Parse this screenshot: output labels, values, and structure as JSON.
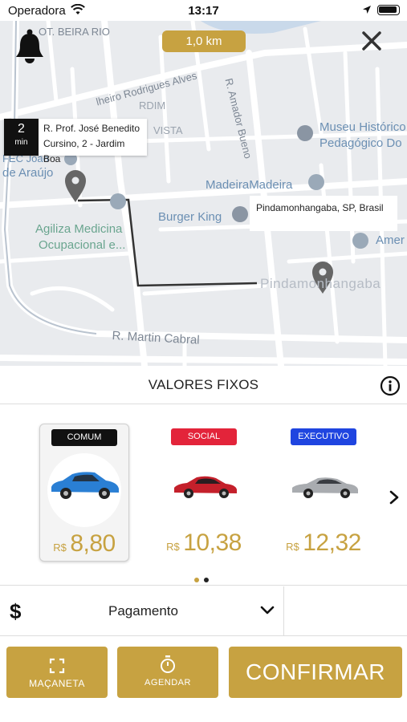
{
  "status_bar": {
    "carrier": "Operadora",
    "time": "13:17"
  },
  "map": {
    "distance": "1,0 km",
    "streets": [
      "OT. BEIRA RIO",
      "lheiro Rodrigues Alves",
      "R. Amador Bueno",
      "R. Martin Cabral"
    ],
    "pois": [
      "Museu Histórico",
      "Pedagógico Do",
      "MadeiraMadeira",
      "Burger King",
      "Agiliza Medicina",
      "Ocupacional e...",
      "Amer",
      "RDIM",
      "VISTA",
      "de Araújo",
      "FEC João"
    ],
    "town": "Pindamonhangaba",
    "origin": {
      "eta_value": "2",
      "eta_unit": "min",
      "address_line1": "R. Prof. José Benedito",
      "address_line2": "Cursino, 2 - Jardim Boa"
    },
    "destination": "Pindamonhangaba, SP, Brasil"
  },
  "fixed_values": {
    "title": "VALORES FIXOS"
  },
  "cars": [
    {
      "category": "COMUM",
      "currency": "R$",
      "price": "8,80",
      "badge_color": "#111111",
      "car_color": "#2a7fd4",
      "selected": true
    },
    {
      "category": "SOCIAL",
      "currency": "R$",
      "price": "10,38",
      "badge_color": "#e3243a",
      "car_color": "#c4202b",
      "selected": false
    },
    {
      "category": "EXECUTIVO",
      "currency": "R$",
      "price": "12,32",
      "badge_color": "#1f45e0",
      "car_color": "#a9acb0",
      "selected": false
    }
  ],
  "carousel": {
    "page": 1,
    "pages": 2
  },
  "payment": {
    "icon": "$",
    "label": "Pagamento"
  },
  "actions": {
    "handle_label": "MAÇANETA",
    "schedule_label": "AGENDAR",
    "confirm_label": "CONFIRMAR"
  },
  "colors": {
    "gold": "#c7a241",
    "map_bg": "#e9ebee",
    "route": "#333333",
    "pin": "#666666"
  },
  "icons": {
    "bell": "bell-icon",
    "close": "close-icon",
    "info": "info-icon",
    "next": "chevron-right-icon",
    "payment": "dollar-icon",
    "dropdown": "chevron-down-icon",
    "handle": "expand-frame-icon",
    "schedule": "stopwatch-icon"
  }
}
